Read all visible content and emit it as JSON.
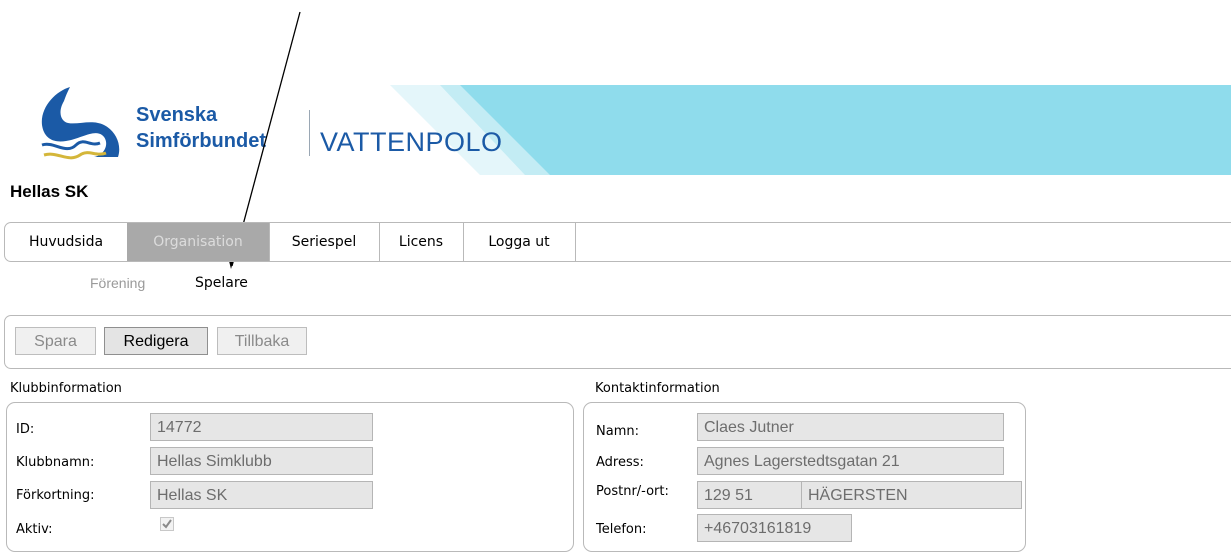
{
  "header": {
    "org_line1": "Svenska",
    "org_line2": "Simförbundet",
    "sport": "VATTENPOLO",
    "accent_color": "#1b5aa6",
    "banner_color": "#8fdcec"
  },
  "club_name": "Hellas SK",
  "main_nav": {
    "tabs": [
      {
        "label": "Huvudsida",
        "active": false
      },
      {
        "label": "Organisation",
        "active": true
      },
      {
        "label": "Seriespel",
        "active": false
      },
      {
        "label": "Licens",
        "active": false
      },
      {
        "label": "Logga ut",
        "active": false
      }
    ]
  },
  "sub_nav": {
    "items": [
      {
        "label": "Förening",
        "active": true
      },
      {
        "label": "Spelare",
        "active": false
      }
    ]
  },
  "toolbar": {
    "save_label": "Spara",
    "edit_label": "Redigera",
    "back_label": "Tillbaka"
  },
  "club_info": {
    "title": "Klubbinformation",
    "id_label": "ID:",
    "id_value": "14772",
    "name_label": "Klubbnamn:",
    "name_value": "Hellas Simklubb",
    "abbr_label": "Förkortning:",
    "abbr_value": "Hellas SK",
    "active_label": "Aktiv:",
    "active_checked": true
  },
  "contact_info": {
    "title": "Kontaktinformation",
    "name_label": "Namn:",
    "name_value": "Claes Jutner",
    "address_label": "Adress:",
    "address_value": "Agnes Lagerstedtsgatan 21",
    "postal_label": "Postnr/-ort:",
    "postal_code": "129 51",
    "city": "HÄGERSTEN",
    "phone_label": "Telefon:",
    "phone_value": "+46703161819"
  }
}
